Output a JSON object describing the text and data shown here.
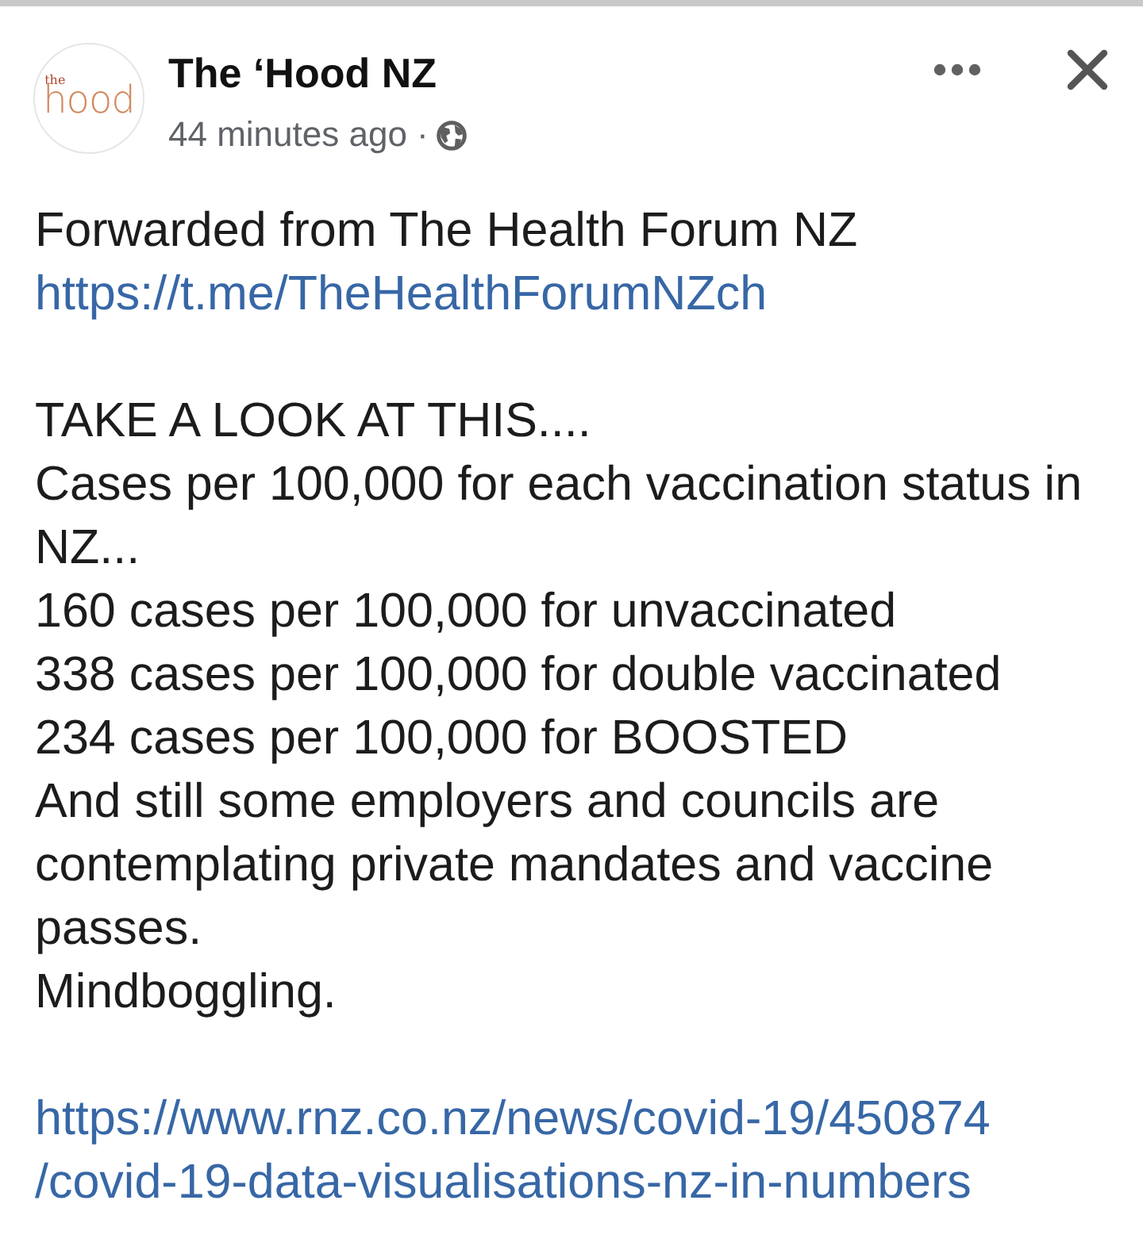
{
  "post": {
    "avatar": {
      "logo_small": "the",
      "logo_word": "hood"
    },
    "page_name": "The ‘Hood NZ",
    "time": "44 minutes ago",
    "separator": "·",
    "paragraphs": [
      {
        "lines": [
          {
            "kind": "text",
            "text": "Forwarded from The Health Forum NZ"
          },
          {
            "kind": "link",
            "text": "https://t.me/TheHealthForumNZch"
          }
        ]
      },
      {
        "lines": [
          {
            "kind": "text",
            "text": "TAKE A LOOK AT THIS...."
          },
          {
            "kind": "text",
            "text": "Cases per 100,000 for each vaccination status in NZ..."
          },
          {
            "kind": "text",
            "text": "160 cases per 100,000 for unvaccinated"
          },
          {
            "kind": "text",
            "text": "338 cases per 100,000 for double vaccinated"
          },
          {
            "kind": "text",
            "text": "234 cases per 100,000 for BOOSTED"
          },
          {
            "kind": "text",
            "text": "And still some employers and councils are contemplating private mandates and vaccine passes."
          },
          {
            "kind": "text",
            "text": "Mindboggling."
          }
        ]
      },
      {
        "lines": [
          {
            "kind": "link",
            "text_lines": [
              "https://www.rnz.co.nz/news/covid-19/450874",
              "/covid-19-data-visualisations-nz-in-numbers"
            ]
          }
        ]
      }
    ]
  }
}
